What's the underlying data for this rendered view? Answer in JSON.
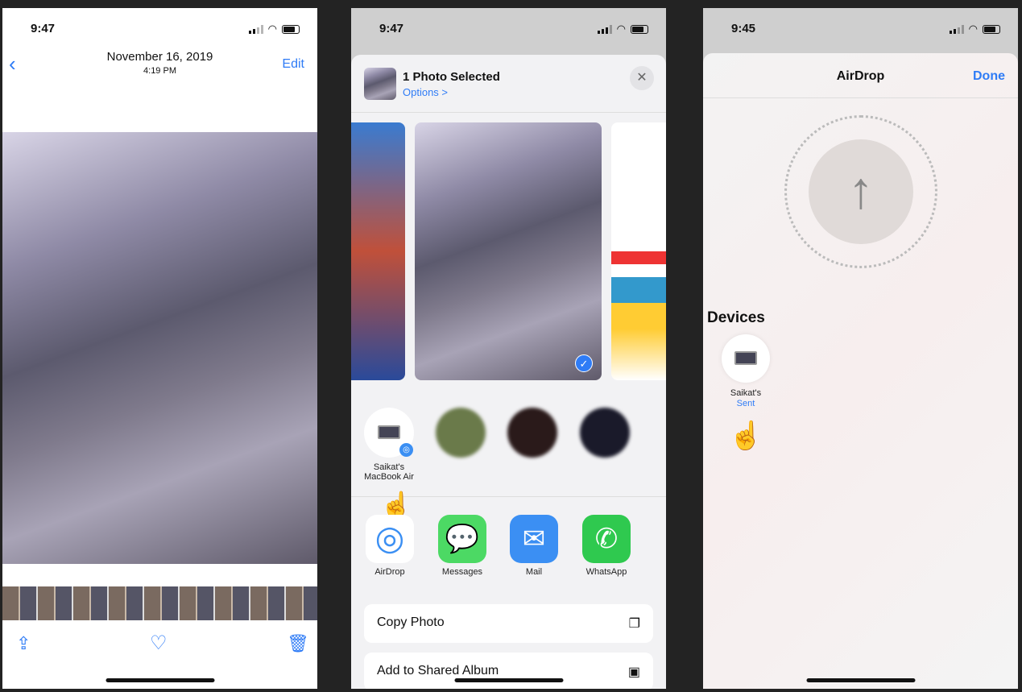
{
  "panel1": {
    "time": "9:47",
    "date": "November 16, 2019",
    "clock": "4:19 PM",
    "back_icon": "chevron-left",
    "edit": "Edit",
    "toolbar": [
      "share-icon",
      "heart-icon",
      "trash-icon"
    ]
  },
  "panel2": {
    "time": "9:47",
    "header_title": "1 Photo Selected",
    "options": "Options >",
    "close_icon": "close-icon",
    "people": [
      {
        "name": "Saikat's MacBook Air",
        "line1": "Saikat's",
        "line2": "MacBook Air"
      }
    ],
    "apps": [
      {
        "label": "AirDrop",
        "color": "#ffffff"
      },
      {
        "label": "Messages",
        "color": "#4cd964"
      },
      {
        "label": "Mail",
        "color": "#3b8ff3"
      },
      {
        "label": "WhatsApp",
        "color": "#2fc94f"
      }
    ],
    "actions": [
      {
        "label": "Copy Photo",
        "icon": "copy-icon"
      },
      {
        "label": "Add to Shared Album",
        "icon": "shared-album-icon"
      }
    ]
  },
  "panel3": {
    "time": "9:45",
    "title": "AirDrop",
    "done": "Done",
    "devices_heading": "Devices",
    "device": {
      "name": "Saikat's",
      "status": "Sent"
    }
  },
  "colors": {
    "accent": "#2f7cf6",
    "background": "#232323"
  }
}
